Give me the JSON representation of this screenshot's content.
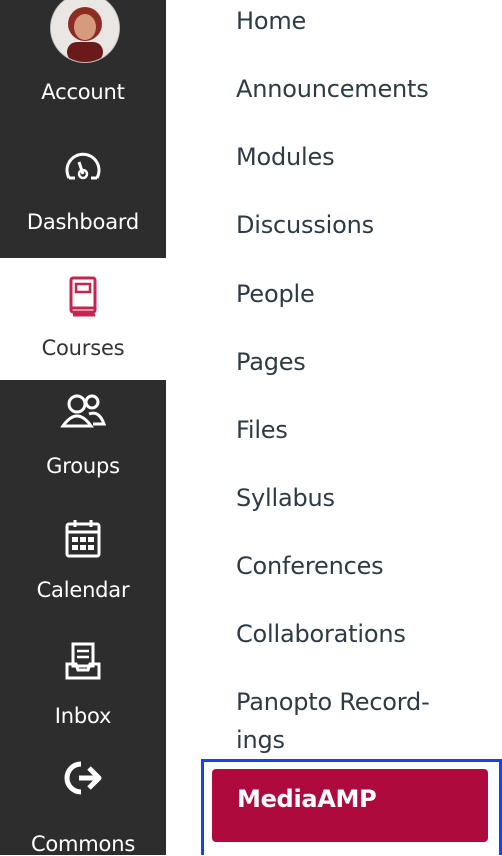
{
  "global_nav": {
    "account": {
      "label": "Account",
      "icon": "avatar"
    },
    "dashboard": {
      "label": "Dashboard",
      "icon": "dashboard-gauge-icon"
    },
    "courses": {
      "label": "Courses",
      "icon": "book-icon"
    },
    "groups": {
      "label": "Groups",
      "icon": "people-icon"
    },
    "calendar": {
      "label": "Calendar",
      "icon": "calendar-icon"
    },
    "inbox": {
      "label": "Inbox",
      "icon": "inbox-icon"
    },
    "commons": {
      "label": "Commons",
      "icon": "commons-arrow-icon"
    }
  },
  "course_nav": {
    "items": [
      "Home",
      "Announcements",
      "Modules",
      "Discussions",
      "People",
      "Pages",
      "Files",
      "Syllabus",
      "Conferences",
      "Collaborations",
      "Panopto Record-",
      "ings"
    ],
    "active": "MediaAMP"
  },
  "colors": {
    "sidebar_dark": "#2d2d2d",
    "active_bg": "#ae0a3d",
    "courses_icon": "#c4264f",
    "highlight_border": "#1a41ef",
    "text": "#2d3b45"
  }
}
